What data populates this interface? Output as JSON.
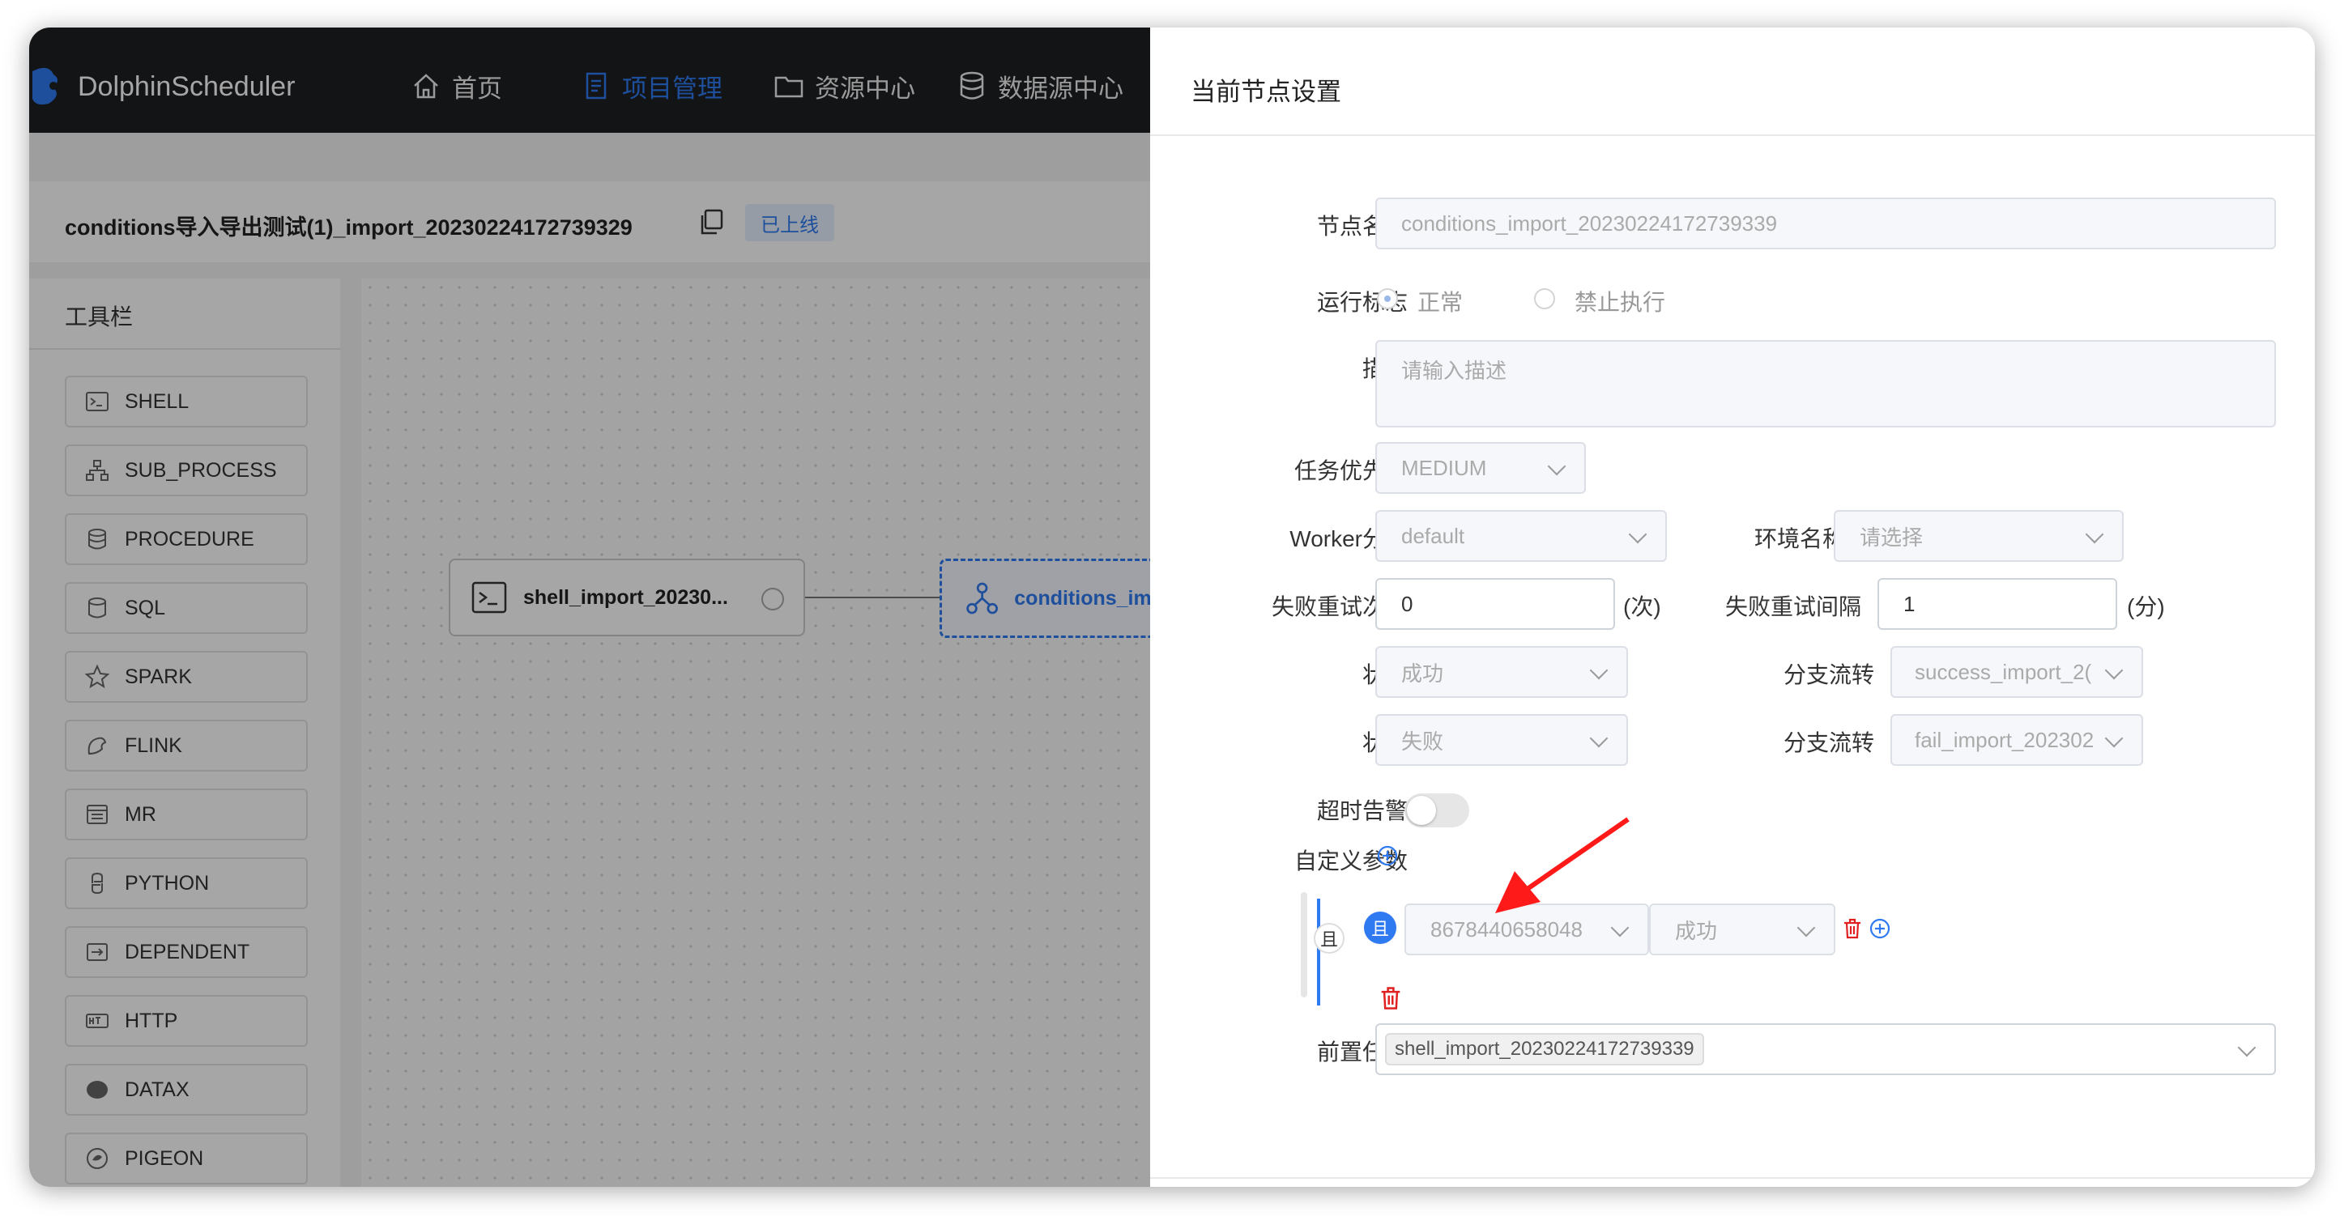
{
  "app": {
    "logo_text": "DolphinScheduler",
    "nav": [
      {
        "label": "首页",
        "icon": "home-icon"
      },
      {
        "label": "项目管理",
        "icon": "document-icon",
        "active": true
      },
      {
        "label": "资源中心",
        "icon": "folder-icon"
      },
      {
        "label": "数据源中心",
        "icon": "database-icon"
      }
    ]
  },
  "workflow": {
    "title": "conditions导入导出测试(1)_import_20230224172739329",
    "status_badge": "已上线"
  },
  "toolbar": {
    "title": "工具栏",
    "items": [
      {
        "label": "SHELL",
        "icon": "shell-icon"
      },
      {
        "label": "SUB_PROCESS",
        "icon": "sub-process-icon"
      },
      {
        "label": "PROCEDURE",
        "icon": "procedure-icon"
      },
      {
        "label": "SQL",
        "icon": "sql-icon"
      },
      {
        "label": "SPARK",
        "icon": "spark-icon"
      },
      {
        "label": "FLINK",
        "icon": "flink-icon"
      },
      {
        "label": "MR",
        "icon": "mr-icon"
      },
      {
        "label": "PYTHON",
        "icon": "python-icon"
      },
      {
        "label": "DEPENDENT",
        "icon": "dependent-icon"
      },
      {
        "label": "HTTP",
        "icon": "http-icon"
      },
      {
        "label": "DATAX",
        "icon": "datax-icon"
      },
      {
        "label": "PIGEON",
        "icon": "pigeon-icon"
      }
    ]
  },
  "canvas": {
    "nodes": [
      {
        "label": "shell_import_20230...",
        "type": "shell"
      },
      {
        "label": "conditions_imp",
        "type": "conditions"
      }
    ]
  },
  "drawer": {
    "title": "当前节点设置",
    "node_name": {
      "label": "节点名称",
      "value": "conditions_import_20230224172739339"
    },
    "run_flag": {
      "label": "运行标志",
      "options": [
        "正常",
        "禁止执行"
      ],
      "selected": "正常"
    },
    "description": {
      "label": "描述",
      "placeholder": "请输入描述"
    },
    "priority": {
      "label": "任务优先级",
      "value": "MEDIUM"
    },
    "worker_group": {
      "label": "Worker分组",
      "value": "default"
    },
    "environment": {
      "label": "环境名称",
      "placeholder": "请选择"
    },
    "retry_times": {
      "label": "失败重试次数",
      "value": "0",
      "unit": "(次)"
    },
    "retry_interval": {
      "label": "失败重试间隔",
      "value": "1",
      "unit": "(分)"
    },
    "branches": [
      {
        "state_label": "状态",
        "state": "成功",
        "flow_label": "分支流转",
        "flow": "success_import_2("
      },
      {
        "state_label": "状态",
        "state": "失败",
        "flow_label": "分支流转",
        "flow": "fail_import_202302"
      }
    ],
    "timeout_alarm": {
      "label": "超时告警",
      "enabled": false
    },
    "custom_params": {
      "label": "自定义参数",
      "outer_relation": "且",
      "inner_relation": "且",
      "condition": {
        "task": "8678440658048",
        "status": "成功"
      }
    },
    "pre_tasks": {
      "label": "前置任务",
      "tags": [
        "shell_import_20230224172739339"
      ]
    }
  },
  "colors": {
    "accent": "#2f7af0",
    "danger": "#e02020",
    "header_bg": "#1e1f23"
  }
}
